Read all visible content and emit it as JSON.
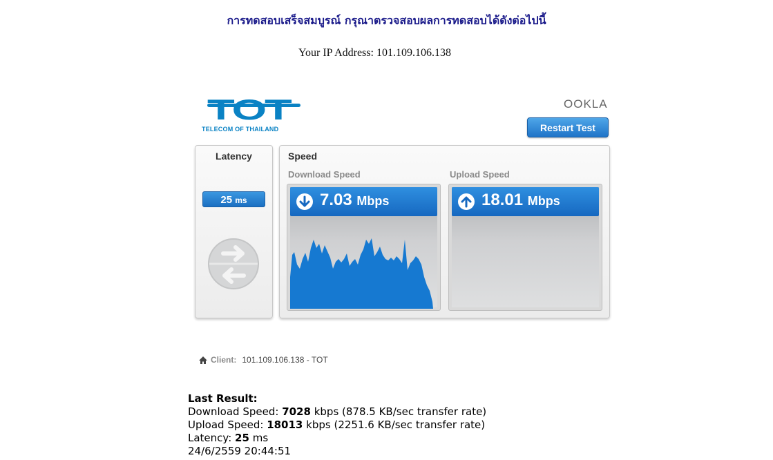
{
  "header": {
    "message": "การทดสอบเสร็จสมบูรณ์ กรุณาตรวจสอบผลการทดสอบได้ดังต่อไปนี้",
    "ip_label": "Your IP Address:",
    "ip_value": "101.109.106.138"
  },
  "branding": {
    "logo_word": "TOT",
    "logo_sub": "TELECOM OF THAILAND",
    "partner": "OOKLA",
    "accent": "#0a82c4"
  },
  "toolbar": {
    "restart_label": "Restart Test"
  },
  "latency": {
    "title": "Latency",
    "value": "25",
    "unit": "ms",
    "icon": "exchange-arrows-icon"
  },
  "speed": {
    "title": "Speed",
    "download": {
      "label": "Download Speed",
      "value": "7.03",
      "unit": "Mbps",
      "icon": "arrow-down-icon"
    },
    "upload": {
      "label": "Upload Speed",
      "value": "18.01",
      "unit": "Mbps",
      "icon": "arrow-up-icon"
    }
  },
  "client": {
    "label": "Client:",
    "value": "101.109.106.138 - TOT"
  },
  "result": {
    "title": "Last Result:",
    "download_label": "Download Speed:",
    "download_value": "7028",
    "download_tail": "kbps (878.5 KB/sec transfer rate)",
    "upload_label": "Upload Speed:",
    "upload_value": "18013",
    "upload_tail": "kbps (2251.6 KB/sec transfer rate)",
    "latency_label": "Latency:",
    "latency_value": "25",
    "latency_unit": "ms",
    "timestamp": "24/6/2559 20:44:51"
  }
}
